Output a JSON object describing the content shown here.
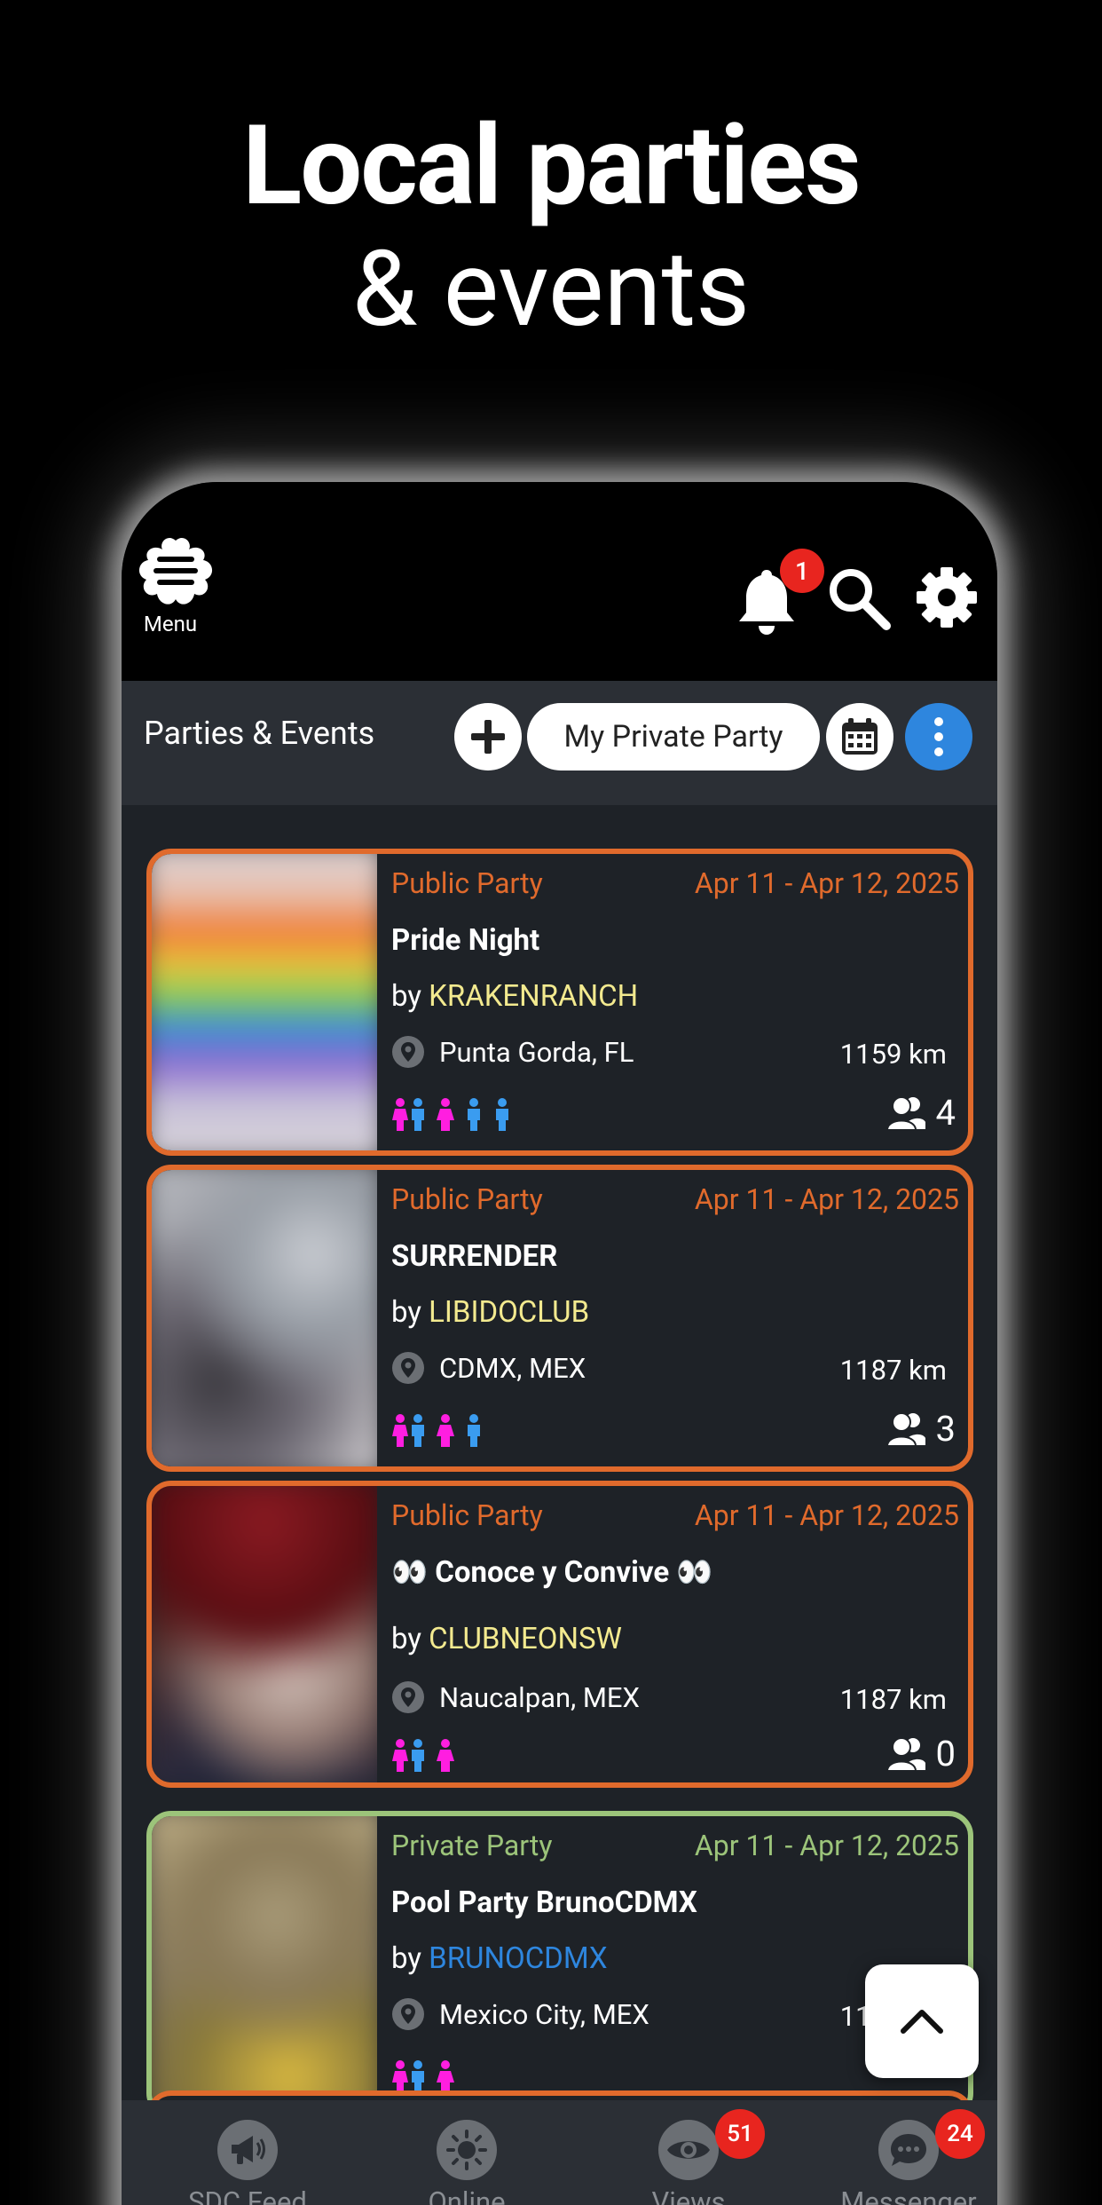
{
  "headline": {
    "line1": "Local parties",
    "line2": "& events"
  },
  "topbar": {
    "menu_label": "Menu",
    "notification_count": "1"
  },
  "toolbar": {
    "title": "Parties & Events",
    "my_party_label": "My Private Party",
    "accent": "#2e86de"
  },
  "events": [
    {
      "type": "Public Party",
      "dates": "Apr 11 - Apr 12, 2025",
      "title": "Pride Night",
      "by": "by ",
      "host": "KRAKENRANCH",
      "location": "Punta Gorda, FL",
      "distance": "1159 km",
      "attendees": "4",
      "genders": [
        "couple-icon",
        "female-icon",
        "male-icon",
        "male-icon"
      ]
    },
    {
      "type": "Public Party",
      "dates": "Apr 11 - Apr 12, 2025",
      "title": "SURRENDER",
      "by": "by ",
      "host": "LIBIDOCLUB",
      "location": "CDMX, MEX",
      "distance": "1187 km",
      "attendees": "3",
      "genders": [
        "couple-icon",
        "female-icon",
        "male-icon"
      ]
    },
    {
      "type": "Public Party",
      "dates": "Apr 11 - Apr 12, 2025",
      "title": "👀  Conoce y Convive 👀",
      "by": "by ",
      "host": "CLUBNEONSW",
      "location": "Naucalpan, MEX",
      "distance": "1187 km",
      "attendees": "0",
      "genders": [
        "couple-icon",
        "female-icon"
      ]
    },
    {
      "type": "Private Party",
      "dates": "Apr 11 - Apr 12, 2025",
      "title": "Pool Party BrunoCDMX",
      "by": "by ",
      "host": "BRUNOCDMX",
      "location": "Mexico City, MEX",
      "distance": "1187 km",
      "attendees": "",
      "genders": [
        "couple-icon",
        "female-icon"
      ]
    }
  ],
  "colors": {
    "public_border": "#e06a2c",
    "private_border": "#9cc47a",
    "host_public": "#f3ea8f",
    "host_private": "#2e86de",
    "female": "#ff1ee0",
    "male": "#3a9cf0",
    "badge": "#e8251f"
  },
  "nav": [
    {
      "label": "SDC Feed",
      "icon": "megaphone-icon",
      "badge": ""
    },
    {
      "label": "Online",
      "icon": "sun-icon",
      "badge": ""
    },
    {
      "label": "Views",
      "icon": "eye-icon",
      "badge": "51"
    },
    {
      "label": "Messenger",
      "icon": "chat-icon",
      "badge": "24"
    }
  ]
}
